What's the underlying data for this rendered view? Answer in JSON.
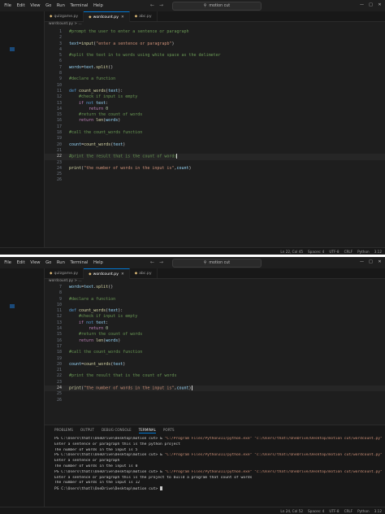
{
  "menu": [
    "File",
    "Edit",
    "View",
    "Go",
    "Run",
    "Terminal",
    "Help"
  ],
  "search": {
    "label": "motion cut"
  },
  "tabs": [
    {
      "label": "qulzgame.py",
      "active": false
    },
    {
      "label": "wordcount.py",
      "active": true
    },
    {
      "label": "abc.py",
      "active": false
    }
  ],
  "tabs2": [
    {
      "label": "qulzgame.py",
      "active": false
    },
    {
      "label": "wordcount.py",
      "active": true
    },
    {
      "label": "abc.py",
      "active": false
    }
  ],
  "breadcrumb": "wordcount.py > ...",
  "code1": [
    {
      "n": 1,
      "tokens": [
        [
          "cmt",
          "#prompt the user to enter a sentence or paragraph"
        ]
      ]
    },
    {
      "n": 2,
      "tokens": []
    },
    {
      "n": 3,
      "tokens": [
        [
          "var",
          "text"
        ],
        [
          "txt",
          "="
        ],
        [
          "fn",
          "input"
        ],
        [
          "txt",
          "("
        ],
        [
          "str",
          "\"enter a sentence or paragrapb\""
        ],
        [
          "txt",
          ")"
        ]
      ]
    },
    {
      "n": 4,
      "tokens": []
    },
    {
      "n": 5,
      "tokens": [
        [
          "cmt",
          "#split the text in to words using white space as the delimeter"
        ]
      ]
    },
    {
      "n": 6,
      "tokens": []
    },
    {
      "n": 7,
      "tokens": [
        [
          "var",
          "words"
        ],
        [
          "txt",
          "="
        ],
        [
          "var",
          "text"
        ],
        [
          "txt",
          "."
        ],
        [
          "fn",
          "split"
        ],
        [
          "txt",
          "()"
        ]
      ]
    },
    {
      "n": 8,
      "tokens": []
    },
    {
      "n": 9,
      "tokens": [
        [
          "cmt",
          "#declare a function"
        ]
      ]
    },
    {
      "n": 10,
      "tokens": []
    },
    {
      "n": 11,
      "tokens": [
        [
          "kw2",
          "def "
        ],
        [
          "fn",
          "count_words"
        ],
        [
          "txt",
          "("
        ],
        [
          "var",
          "text"
        ],
        [
          "txt",
          "):"
        ]
      ]
    },
    {
      "n": 12,
      "tokens": [
        [
          "cmt",
          "    #check if input is empty"
        ]
      ]
    },
    {
      "n": 13,
      "tokens": [
        [
          "kw",
          "    if "
        ],
        [
          "kw2",
          "not "
        ],
        [
          "var",
          "text"
        ],
        [
          "txt",
          ":"
        ]
      ]
    },
    {
      "n": 14,
      "tokens": [
        [
          "kw",
          "        return "
        ],
        [
          "num",
          "0"
        ]
      ]
    },
    {
      "n": 15,
      "tokens": [
        [
          "cmt",
          "    #return the count of words"
        ]
      ]
    },
    {
      "n": 16,
      "tokens": [
        [
          "kw",
          "    return "
        ],
        [
          "fn",
          "len"
        ],
        [
          "txt",
          "("
        ],
        [
          "var",
          "words"
        ],
        [
          "txt",
          ")"
        ]
      ]
    },
    {
      "n": 17,
      "tokens": []
    },
    {
      "n": 18,
      "tokens": [
        [
          "cmt",
          "#call the count_words function"
        ]
      ]
    },
    {
      "n": 19,
      "tokens": []
    },
    {
      "n": 20,
      "tokens": [
        [
          "var",
          "count"
        ],
        [
          "txt",
          "="
        ],
        [
          "fn",
          "count_words"
        ],
        [
          "txt",
          "("
        ],
        [
          "var",
          "text"
        ],
        [
          "txt",
          ")"
        ]
      ]
    },
    {
      "n": 21,
      "tokens": []
    },
    {
      "n": 22,
      "tokens": [
        [
          "cmt",
          "#print the result that is the count of words"
        ]
      ],
      "current": true
    },
    {
      "n": 23,
      "tokens": []
    },
    {
      "n": 24,
      "tokens": [
        [
          "fn",
          "print"
        ],
        [
          "txt",
          "("
        ],
        [
          "str",
          "\"the number of words in the input is\""
        ],
        [
          "txt",
          ","
        ],
        [
          "var",
          "count"
        ],
        [
          "txt",
          ")"
        ]
      ]
    },
    {
      "n": 25,
      "tokens": []
    },
    {
      "n": 26,
      "tokens": []
    }
  ],
  "code2": [
    {
      "n": 7,
      "tokens": [
        [
          "var",
          "words"
        ],
        [
          "txt",
          "="
        ],
        [
          "var",
          "text"
        ],
        [
          "txt",
          "."
        ],
        [
          "fn",
          "split"
        ],
        [
          "txt",
          "()"
        ]
      ]
    },
    {
      "n": 8,
      "tokens": []
    },
    {
      "n": 9,
      "tokens": [
        [
          "cmt",
          "#declare a function"
        ]
      ]
    },
    {
      "n": 10,
      "tokens": []
    },
    {
      "n": 11,
      "tokens": [
        [
          "kw2",
          "def "
        ],
        [
          "fn",
          "count_words"
        ],
        [
          "txt",
          "("
        ],
        [
          "var",
          "text"
        ],
        [
          "txt",
          "):"
        ]
      ]
    },
    {
      "n": 12,
      "tokens": [
        [
          "cmt",
          "    #check if input is empty"
        ]
      ]
    },
    {
      "n": 13,
      "tokens": [
        [
          "kw",
          "    if "
        ],
        [
          "kw2",
          "not "
        ],
        [
          "var",
          "text"
        ],
        [
          "txt",
          ":"
        ]
      ]
    },
    {
      "n": 14,
      "tokens": [
        [
          "kw",
          "        return "
        ],
        [
          "num",
          "0"
        ]
      ]
    },
    {
      "n": 15,
      "tokens": [
        [
          "cmt",
          "    #return the count of words"
        ]
      ]
    },
    {
      "n": 16,
      "tokens": [
        [
          "kw",
          "    return "
        ],
        [
          "fn",
          "len"
        ],
        [
          "txt",
          "("
        ],
        [
          "var",
          "words"
        ],
        [
          "txt",
          ")"
        ]
      ]
    },
    {
      "n": 17,
      "tokens": []
    },
    {
      "n": 18,
      "tokens": [
        [
          "cmt",
          "#call the count_words function"
        ]
      ]
    },
    {
      "n": 19,
      "tokens": []
    },
    {
      "n": 20,
      "tokens": [
        [
          "var",
          "count"
        ],
        [
          "txt",
          "="
        ],
        [
          "fn",
          "count_words"
        ],
        [
          "txt",
          "("
        ],
        [
          "var",
          "text"
        ],
        [
          "txt",
          ")"
        ]
      ]
    },
    {
      "n": 21,
      "tokens": []
    },
    {
      "n": 22,
      "tokens": [
        [
          "cmt",
          "#print the result that is the count of words"
        ]
      ]
    },
    {
      "n": 23,
      "tokens": []
    },
    {
      "n": 24,
      "tokens": [
        [
          "fn",
          "print"
        ],
        [
          "txt",
          "("
        ],
        [
          "str",
          "\"the number of words in the input is\""
        ],
        [
          "txt",
          ","
        ],
        [
          "var",
          "count"
        ],
        [
          "txt",
          ")"
        ]
      ],
      "current": true
    },
    {
      "n": 25,
      "tokens": []
    },
    {
      "n": 26,
      "tokens": []
    }
  ],
  "panel_tabs": [
    "PROBLEMS",
    "OUTPUT",
    "DEBUG CONSOLE",
    "TERMINAL",
    "PORTS"
  ],
  "panel_active": "TERMINAL",
  "terminal": [
    {
      "prompt": "PS C:\\Users\\thatl\\OneDrive\\Desktop\\motion cut> & ",
      "path": "\"C:/Program Files/Python311/python.exe\" \"c:/Users/thatl/OneDrive/Desktop/motion cut/wordcount.py\""
    },
    {
      "text": "Enter a sentence or paragraph this is the python project"
    },
    {
      "text": "The number of words in the input is 5"
    },
    {
      "prompt": "PS C:\\Users\\thatl\\OneDrive\\Desktop\\motion cut> & ",
      "path": "\"C:/Program Files/Python311/python.exe\" \"c:/Users/thatl/OneDrive/Desktop/motion cut/wordcount.py\""
    },
    {
      "text": "Enter a sentence or paragraph"
    },
    {
      "text": "The number of words in the input is 0"
    },
    {
      "prompt": "PS C:\\Users\\thatl\\OneDrive\\Desktop\\motion cut> & ",
      "path": "\"C:/Program Files/Python311/python.exe\" \"c:/Users/thatl/OneDrive/Desktop/motion cut/wordcount.py\""
    },
    {
      "text": "Enter a sentence or paragraph this is the project to build a program that count of words"
    },
    {
      "text": "The number of words in the input is 12"
    },
    {
      "prompt": "PS C:\\Users\\thatl\\OneDrive\\Desktop\\motion cut> ",
      "cursor": true
    }
  ],
  "status1": [
    "Ln 22, Col 45",
    "Spaces: 4",
    "UTF-8",
    "CRLF",
    "Python",
    "3.12"
  ],
  "status2": [
    "Ln 24, Col 52",
    "Spaces: 4",
    "UTF-8",
    "CRLF",
    "Python",
    "3.12"
  ],
  "colors": {
    "accent": "#0078d4",
    "editor_bg": "#1e1e1e",
    "comment": "#6a9955",
    "string": "#ce9178"
  }
}
